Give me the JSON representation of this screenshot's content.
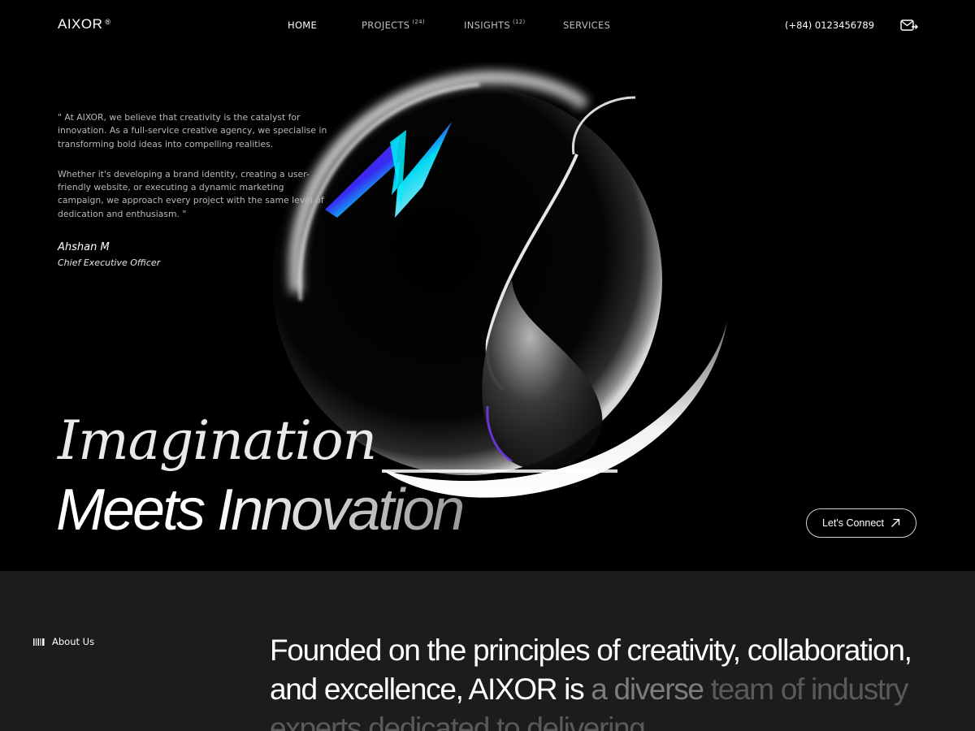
{
  "brand": {
    "name": "AIXOR",
    "mark": "®"
  },
  "nav": {
    "items": [
      {
        "label": "HOME",
        "count": ""
      },
      {
        "label": "PROJECTS",
        "count": "(24)"
      },
      {
        "label": "INSIGHTS",
        "count": "(12)"
      },
      {
        "label": "SERVICES",
        "count": ""
      }
    ],
    "phone": "(+84) 0123456789",
    "mail_icon": "mail-arrow-icon"
  },
  "quote": {
    "paragraph1": "\" At AIXOR, we believe that creativity is the catalyst for innovation. As a full-service creative agency, we specialise in transforming bold ideas into compelling realities.",
    "paragraph2": "Whether it's developing a brand identity, creating a user-friendly website, or executing a dynamic marketing campaign, we approach every project with the same level of dedication and enthusiasm. \"",
    "author": "Ahshan M",
    "role": "Chief Executive Officer"
  },
  "headline": {
    "line1": "Imagination",
    "line2": "Meets Innovation"
  },
  "cta": {
    "label": "Let's Connect",
    "icon": "arrow-up-right-icon"
  },
  "about": {
    "label": "About Us",
    "icon": "barcode-icon",
    "text_bright": "Founded on the principles of creativity, collaboration, and excellence, AIXOR is ",
    "text_dim": "a diverse",
    "text_dimmer": " team of industry experts dedicated to delivering"
  },
  "colors": {
    "background": "#000000",
    "about_background": "#1c1c1c",
    "text": "#ffffff",
    "muted": "#b9b9b9"
  }
}
